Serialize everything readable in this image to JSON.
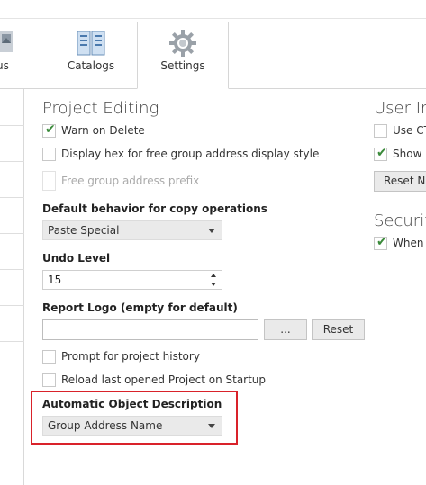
{
  "ribbon": {
    "tabs": [
      {
        "label": "us",
        "icon": "partial-icon"
      },
      {
        "label": "Catalogs",
        "icon": "catalog-book-icon"
      },
      {
        "label": "Settings",
        "icon": "gear-icon"
      }
    ]
  },
  "project_editing": {
    "title": "Project Editing",
    "warn_on_delete": {
      "label": "Warn on Delete",
      "checked": true
    },
    "display_hex": {
      "label": "Display hex for free group address display style",
      "checked": false
    },
    "free_group_prefix": {
      "label": "Free group address prefix",
      "enabled": false
    },
    "copy_behavior": {
      "label": "Default behavior for copy operations",
      "value": "Paste Special"
    },
    "undo_level": {
      "label": "Undo Level",
      "value": "15"
    },
    "report_logo": {
      "label": "Report Logo (empty for default)",
      "value": "",
      "browse_label": "...",
      "reset_label": "Reset"
    },
    "prompt_history": {
      "label": "Prompt for project history",
      "checked": false
    },
    "reload_last": {
      "label": "Reload last opened Project on Startup",
      "checked": false
    },
    "auto_object_desc": {
      "label": "Automatic Object Description",
      "value": "Group Address Name"
    }
  },
  "user_interface": {
    "title": "User Int",
    "use_ctrl": {
      "label": "Use CT",
      "checked": false
    },
    "show": {
      "label": "Show '",
      "checked": true
    },
    "reset_button": "Reset No"
  },
  "security": {
    "title": "Security",
    "when": {
      "label": "When a",
      "checked": true
    }
  },
  "colors": {
    "highlight": "#d9222a",
    "check": "#3a8a3a"
  }
}
